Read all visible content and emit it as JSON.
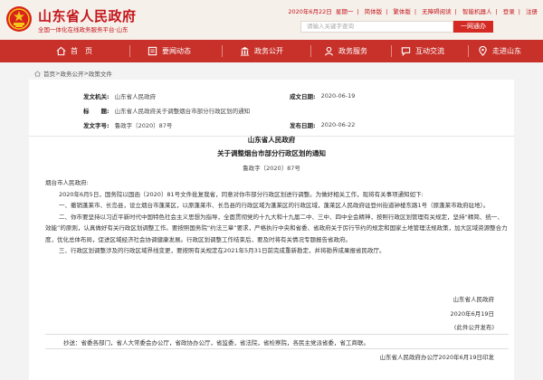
{
  "header": {
    "site_title": "山东省人民政府",
    "site_subtitle": "全国一体化在线政务服务平台·山东",
    "date": "2020年6月22日",
    "weekday": "星期一",
    "links": [
      "简体版",
      "繁体版",
      "无障碍阅读",
      "智能机器人",
      "登录",
      "注册"
    ],
    "search_placeholder": "请输入关键字查询",
    "search_button": "一网通办"
  },
  "nav": {
    "items": [
      {
        "label": "首　页",
        "icon": "home-icon"
      },
      {
        "label": "要闻动态",
        "icon": "news-icon"
      },
      {
        "label": "政务公开",
        "icon": "government-icon"
      },
      {
        "label": "政务服务",
        "icon": "service-icon"
      },
      {
        "label": "互动交流",
        "icon": "interaction-icon"
      },
      {
        "label": "走进山东",
        "icon": "location-icon"
      }
    ]
  },
  "breadcrumb": [
    "首页",
    "政务公开",
    "政策文件"
  ],
  "meta": {
    "issuer_label": "发文机关:",
    "issuer": "山东省人民政府",
    "date_label": "成文日期:",
    "date": "2020-06-19",
    "title_label": "标　　题:",
    "title": "山东省人民政府关于调整烟台市部分行政区划的通知",
    "docno_label": "发文字号:",
    "docno": "鲁政字〔2020〕87号",
    "pubdate_label": "发布日期:",
    "pubdate": "2020-06-22"
  },
  "doc": {
    "org": "山东省人民政府",
    "title": "关于调整烟台市部分行政区划的通知",
    "number": "鲁政字〔2020〕87号",
    "addressee": "烟台市人民政府:",
    "paragraphs": [
      "2020年6月5日，国务院以国函〔2020〕81号文件批复我省，同意对你市部分行政区划进行调整。为做好相关工作，现将有关事项通知如下:",
      "一、撤销蓬莱市、长岛县，设立烟台市蓬莱区，以原蓬莱市、长岛县的行政区域为蓬莱区的行政区域，蓬莱区人民政府驻登州街道钟楼东路1号（原蓬莱市政府驻地）。",
      "二、你市要坚持以习近平新时代中国特色社会主义思想为指导，全面贯彻党的十九大和十九届二中、三中、四中全会精神，按照行政区划管理有关规定，坚持“精简、统一、效能”的原则，认真做好有关行政区划调整工作。要按照国务院“约法三章”要求，严格执行中央和省委、省政府关于厉行节约的规定和国家土地管理法规政策，加大区域资源整合力度，优化总体布局，促进区域经济社会协调健康发展。行政区划调整工作结束后，要及时将有关情况专题报告省政府。",
      "三、行政区划调整涉及的行政区域界线变更，要按照有关规定在2021年5月31日前完成重新勘定，并将勘界成果报省民政厅。"
    ],
    "sign_org": "山东省人民政府",
    "sign_date": "2020年6月19日",
    "sign_note": "(此件公开发布)",
    "cc": "抄送：省委各部门，省人大常委会办公厅，省政协办公厅，省监委，省法院，省检察院，各民主党派省委，省工商联。",
    "footer": "山东省人民政府办公厅2020年6月19日印发"
  },
  "colors": {
    "brand_red": "#c4161c",
    "nav_red": "#c7312a",
    "search_button": "#d42a24"
  }
}
